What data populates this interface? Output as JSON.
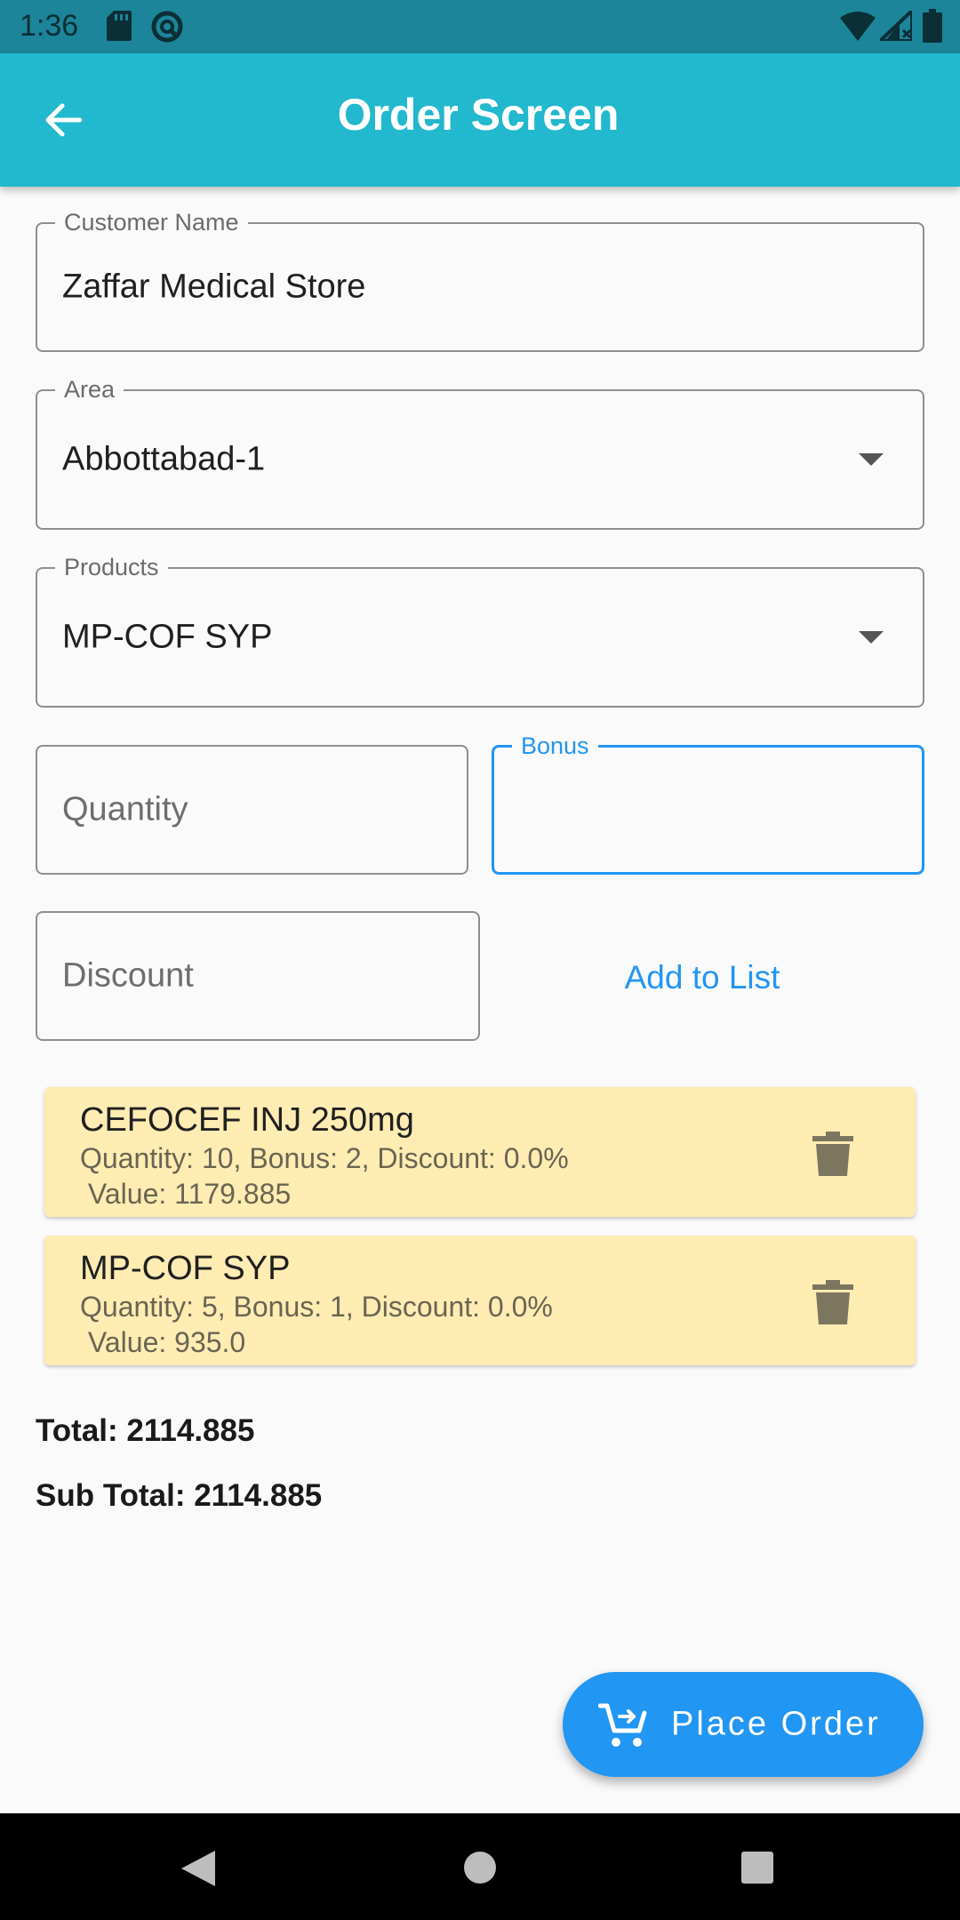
{
  "status_bar": {
    "time": "1:36",
    "icons": [
      "sd-card-icon",
      "sync-circle-icon",
      "wifi-icon",
      "signal-icon",
      "battery-icon"
    ]
  },
  "app_bar": {
    "title": "Order Screen",
    "back_icon": "arrow-left-icon"
  },
  "form": {
    "customer_name": {
      "label": "Customer Name",
      "value": "Zaffar Medical Store"
    },
    "area": {
      "label": "Area",
      "value": "Abbottabad-1"
    },
    "products": {
      "label": "Products",
      "value": "MP-COF SYP"
    },
    "quantity": {
      "placeholder": "Quantity",
      "value": ""
    },
    "bonus": {
      "label": "Bonus",
      "value": "",
      "focused": true
    },
    "discount": {
      "placeholder": "Discount",
      "value": ""
    },
    "add_to_list_label": "Add to List"
  },
  "order_items": [
    {
      "name": "CEFOCEF INJ 250mg",
      "details": "Quantity: 10, Bonus: 2, Discount: 0.0%\n Value: 1179.885"
    },
    {
      "name": "MP-COF SYP",
      "details": "Quantity: 5, Bonus: 1, Discount: 0.0%\n Value: 935.0"
    }
  ],
  "totals": {
    "total": "Total: 2114.885",
    "sub_total": "Sub Total: 2114.885"
  },
  "place_order": {
    "label": "Place Order",
    "icon": "cart-add-icon"
  },
  "colors": {
    "status_bar": "#1c8599",
    "app_bar": "#22b8cd",
    "accent": "#2196f3",
    "card": "#ffecb3",
    "background": "#fafafa"
  }
}
